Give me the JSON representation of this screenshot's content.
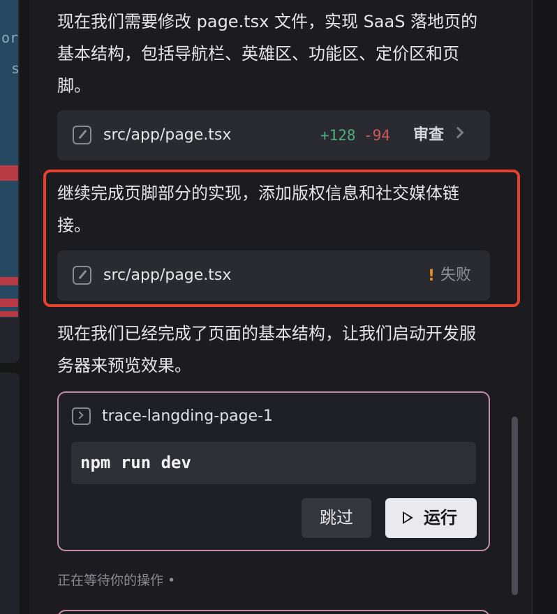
{
  "left_preview": {
    "fragments": [
      "or",
      "s"
    ]
  },
  "messages": [
    {
      "text": "现在我们需要修改 page.tsx 文件，实现 SaaS 落地页的基本结构，包括导航栏、英雄区、功能区、定价区和页脚。"
    },
    {
      "text": "继续完成页脚部分的实现，添加版权信息和社交媒体链接。"
    },
    {
      "text": "现在我们已经完成了页面的基本结构，让我们启动开发服务器来预览效果。"
    }
  ],
  "file_edit_1": {
    "filename": "src/app/page.tsx",
    "additions": "+128",
    "deletions": "-94",
    "review_label": "审查"
  },
  "file_edit_2": {
    "filename": "src/app/page.tsx",
    "status_icon": "!",
    "status_label": "失败"
  },
  "terminal": {
    "name": "trace-langding-page-1",
    "command": "npm run dev",
    "skip_label": "跳过",
    "run_label": "运行"
  },
  "status": {
    "waiting_text": "正在等待你的操作 •"
  },
  "colors": {
    "addition": "#4fb07b",
    "deletion": "#d0575a",
    "highlight": "#e5412f",
    "warning": "#e08a2c"
  }
}
